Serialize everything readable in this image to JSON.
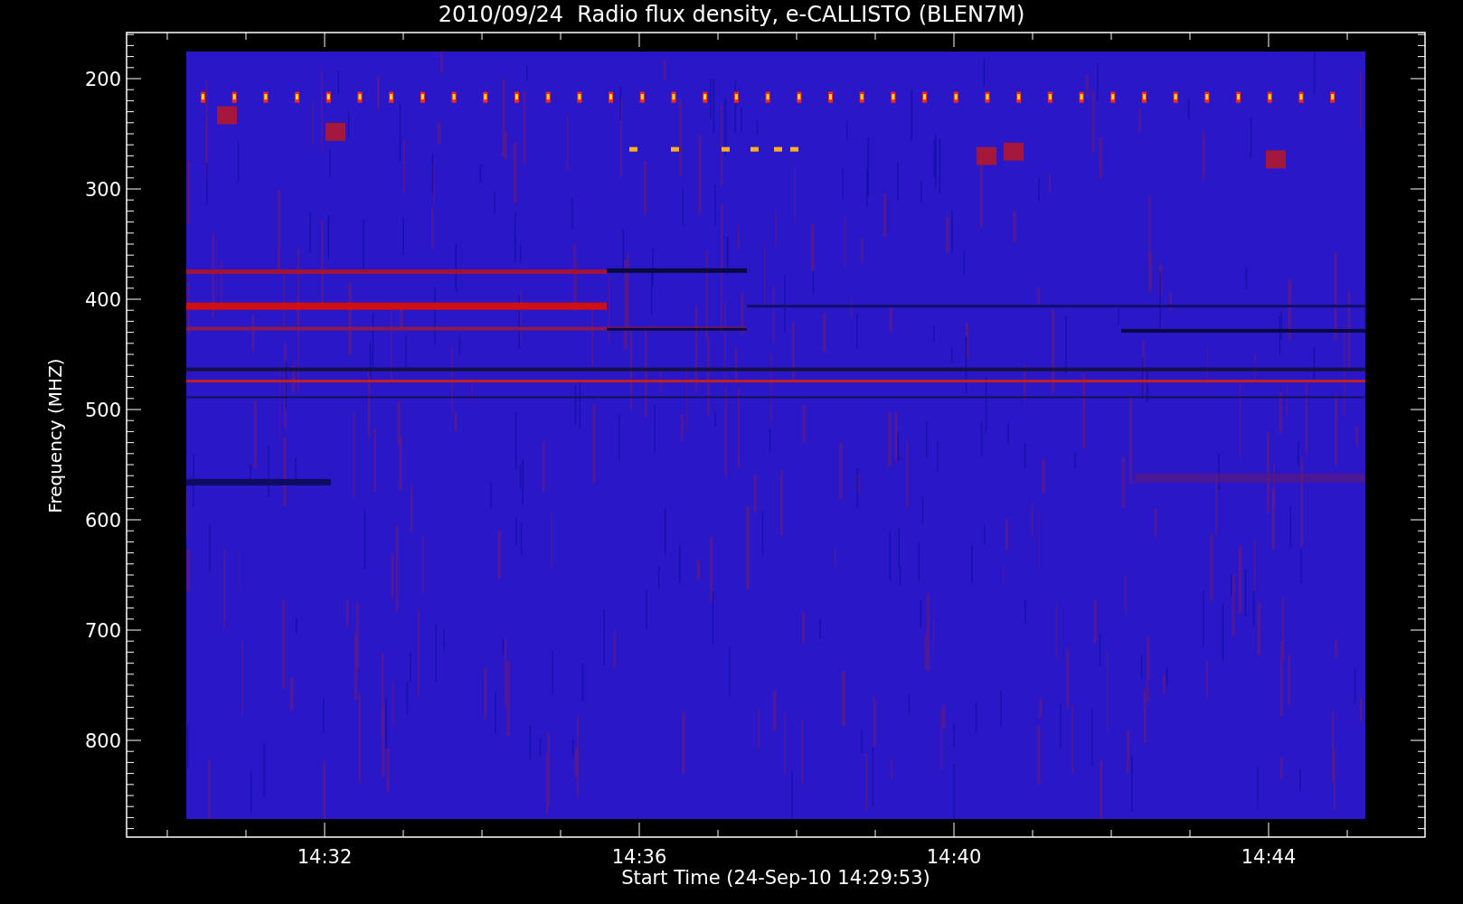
{
  "title": "2010/09/24  Radio flux density, e-CALLISTO (BLEN7M)",
  "y_axis": {
    "label": "Frequency (MHZ)",
    "ticks": [
      "200",
      "300",
      "400",
      "500",
      "600",
      "700",
      "800"
    ]
  },
  "x_axis": {
    "label": "Start Time (24-Sep-10 14:29:53)",
    "ticks": [
      "14:32",
      "14:36",
      "14:40",
      "14:44"
    ]
  }
}
